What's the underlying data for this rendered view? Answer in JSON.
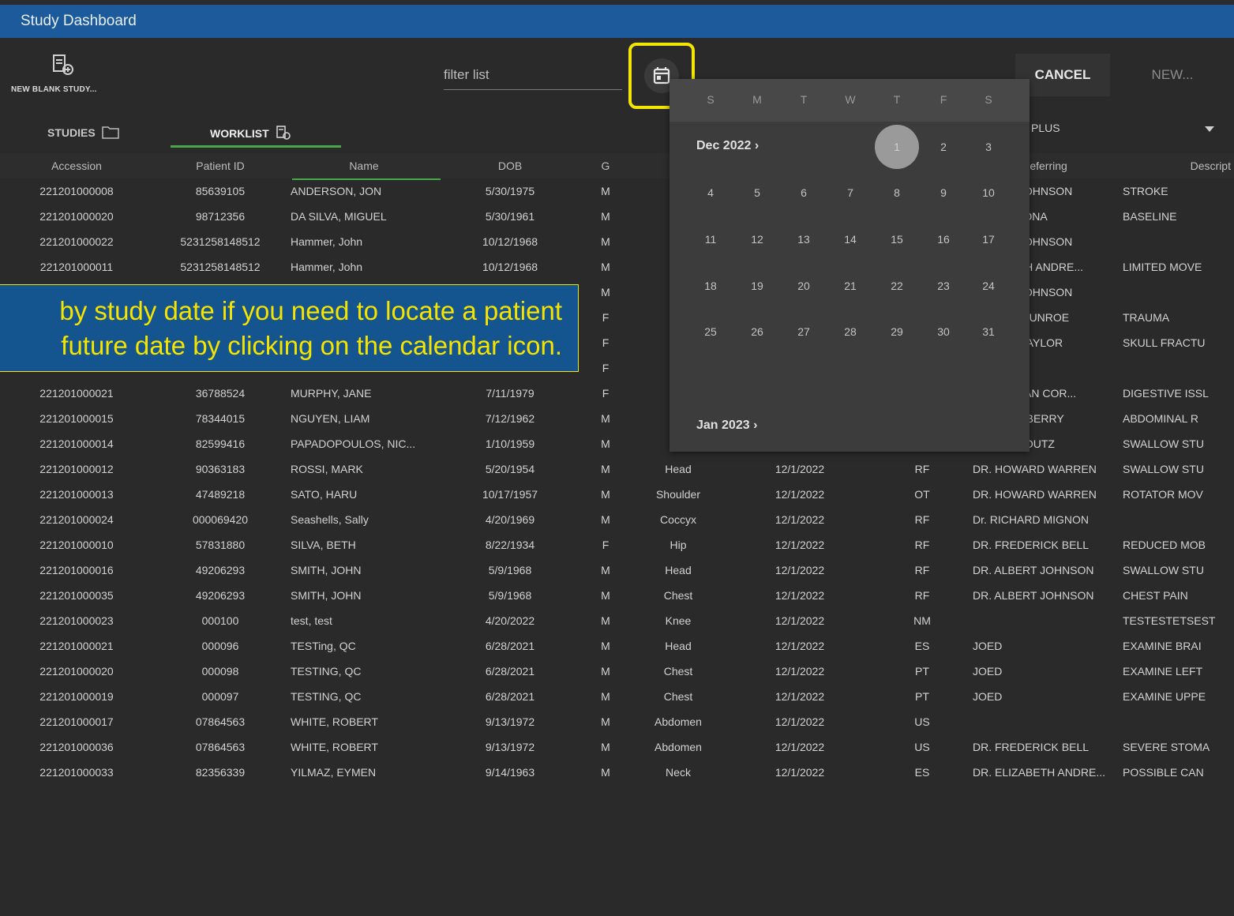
{
  "window": {
    "title": "Study Dashboard"
  },
  "toolbar": {
    "new_blank_study": "NEW BLANK STUDY...",
    "filter_placeholder": "filter list",
    "cancel": "CANCEL",
    "new": "NEW...",
    "modality_dropdown": "PLUS"
  },
  "tabs": [
    {
      "label": "STUDIES",
      "icon": "folder-icon"
    },
    {
      "label": "WORKLIST",
      "icon": "worklist-icon"
    }
  ],
  "columns": [
    "Accession",
    "Patient ID",
    "Name",
    "DOB",
    "G",
    "",
    "",
    "",
    "Referring",
    "Descript"
  ],
  "rows": [
    [
      "221201000008",
      "85639105",
      "ANDERSON, JON",
      "5/30/1975",
      "M",
      "",
      "",
      "",
      "ALBERT JOHNSON",
      "STROKE"
    ],
    [
      "221201000020",
      "98712356",
      "DA SILVA, MIGUEL",
      "5/30/1961",
      "M",
      "",
      "",
      "",
      "IVAN PERONA",
      "BASELINE"
    ],
    [
      "221201000022",
      "5231258148512",
      "Hammer, John",
      "10/12/1968",
      "M",
      "",
      "",
      "",
      "ALBERT JOHNSON",
      ""
    ],
    [
      "221201000011",
      "5231258148512",
      "Hammer, John",
      "10/12/1968",
      "M",
      "",
      "",
      "",
      "ELIZABETH ANDRE...",
      "LIMITED MOVE"
    ],
    [
      "",
      "",
      "",
      "",
      "M",
      "",
      "",
      "",
      "ALBERT JOHNSON",
      ""
    ],
    [
      "",
      "",
      "",
      "",
      "F",
      "",
      "",
      "",
      "JOSEPH MUNROE",
      "TRAUMA"
    ],
    [
      "",
      "",
      "",
      "",
      "F",
      "",
      "",
      "",
      "PALMER TAYLOR",
      "SKULL FRACTU"
    ],
    [
      "",
      "",
      "",
      "",
      "F",
      "",
      "",
      "",
      "",
      ""
    ],
    [
      "221201000021",
      "36788524",
      "MURPHY, JANE",
      "7/11/1979",
      "F",
      "",
      "",
      "",
      "JOHNATHAN COR...",
      "DIGESTIVE ISSL"
    ],
    [
      "221201000015",
      "78344015",
      "NGUYEN, LIAM",
      "7/12/1962",
      "M",
      "",
      "",
      "",
      "RICHARD BERRY",
      "ABDOMINAL R"
    ],
    [
      "221201000014",
      "82599416",
      "PAPADOPOULOS, NIC...",
      "1/10/1959",
      "M",
      "",
      "",
      "",
      "WENDY HOUTZ",
      "SWALLOW STU"
    ],
    [
      "221201000012",
      "90363183",
      "ROSSI, MARK",
      "5/20/1954",
      "M",
      "Head",
      "12/1/2022",
      "RF",
      "DR. HOWARD WARREN",
      "SWALLOW STU"
    ],
    [
      "221201000013",
      "47489218",
      "SATO, HARU",
      "10/17/1957",
      "M",
      "Shoulder",
      "12/1/2022",
      "OT",
      "DR. HOWARD WARREN",
      "ROTATOR MOV"
    ],
    [
      "221201000024",
      "000069420",
      "Seashells, Sally",
      "4/20/1969",
      "M",
      "Coccyx",
      "12/1/2022",
      "RF",
      "Dr. RICHARD MIGNON",
      ""
    ],
    [
      "221201000010",
      "57831880",
      "SILVA, BETH",
      "8/22/1934",
      "F",
      "Hip",
      "12/1/2022",
      "RF",
      "DR. FREDERICK BELL",
      "REDUCED MOB"
    ],
    [
      "221201000016",
      "49206293",
      "SMITH, JOHN",
      "5/9/1968",
      "M",
      "Head",
      "12/1/2022",
      "RF",
      "DR. ALBERT JOHNSON",
      "SWALLOW STU"
    ],
    [
      "221201000035",
      "49206293",
      "SMITH, JOHN",
      "5/9/1968",
      "M",
      "Chest",
      "12/1/2022",
      "RF",
      "DR. ALBERT JOHNSON",
      "CHEST PAIN"
    ],
    [
      "221201000023",
      "000100",
      "test, test",
      "4/20/2022",
      "M",
      "Knee",
      "12/1/2022",
      "NM",
      "",
      "TESTESTETSEST"
    ],
    [
      "221201000021",
      "000096",
      "TESTing, QC",
      "6/28/2021",
      "M",
      "Head",
      "12/1/2022",
      "ES",
      "JOED",
      "EXAMINE BRAI"
    ],
    [
      "221201000020",
      "000098",
      "TESTING, QC",
      "6/28/2021",
      "M",
      "Chest",
      "12/1/2022",
      "PT",
      "JOED",
      "EXAMINE LEFT"
    ],
    [
      "221201000019",
      "000097",
      "TESTING, QC",
      "6/28/2021",
      "M",
      "Chest",
      "12/1/2022",
      "PT",
      "JOED",
      "EXAMINE UPPE"
    ],
    [
      "221201000017",
      "07864563",
      "WHITE, ROBERT",
      "9/13/1972",
      "M",
      "Abdomen",
      "12/1/2022",
      "US",
      "",
      ""
    ],
    [
      "221201000036",
      "07864563",
      "WHITE, ROBERT",
      "9/13/1972",
      "M",
      "Abdomen",
      "12/1/2022",
      "US",
      "DR. FREDERICK BELL",
      "SEVERE STOMA"
    ],
    [
      "221201000033",
      "82356339",
      "YILMAZ, EYMEN",
      "9/14/1963",
      "M",
      "Neck",
      "12/1/2022",
      "ES",
      "DR. ELIZABETH ANDRE...",
      "POSSIBLE CAN"
    ]
  ],
  "calendar": {
    "weekdays": [
      "S",
      "M",
      "T",
      "W",
      "T",
      "F",
      "S"
    ],
    "month1": "Dec 2022",
    "month2": "Jan 2023",
    "today": "1",
    "days": [
      "1",
      "2",
      "3",
      "4",
      "5",
      "6",
      "7",
      "8",
      "9",
      "10",
      "11",
      "12",
      "13",
      "14",
      "15",
      "16",
      "17",
      "18",
      "19",
      "20",
      "21",
      "22",
      "23",
      "24",
      "25",
      "26",
      "27",
      "28",
      "29",
      "30",
      "31"
    ]
  },
  "callout": {
    "line1": "by study date if you need to locate a patient",
    "line2": "future date by clicking on the calendar icon."
  },
  "colors": {
    "titlebar": "#1c5a9c",
    "highlight": "#f2e600",
    "callout_bg": "#14548f",
    "accent_green": "#4aa84a"
  }
}
